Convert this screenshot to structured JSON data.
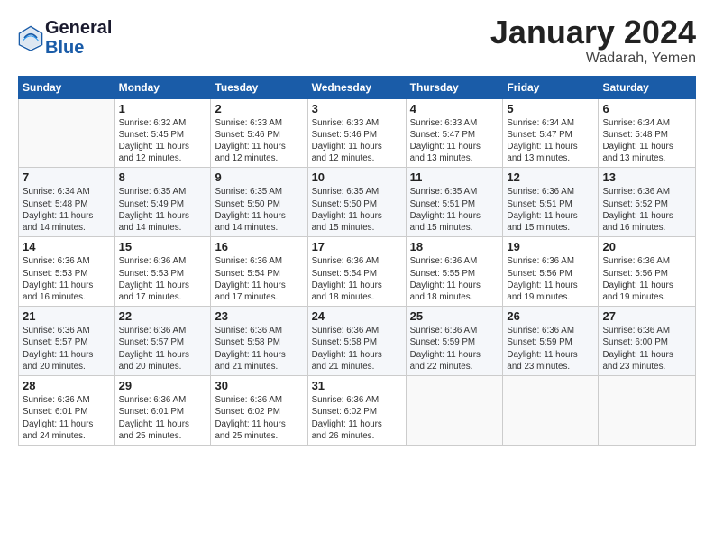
{
  "header": {
    "logo_line1": "General",
    "logo_line2": "Blue",
    "month_title": "January 2024",
    "location": "Wadarah, Yemen"
  },
  "days_of_week": [
    "Sunday",
    "Monday",
    "Tuesday",
    "Wednesday",
    "Thursday",
    "Friday",
    "Saturday"
  ],
  "weeks": [
    [
      {
        "day": "",
        "info": ""
      },
      {
        "day": "1",
        "info": "Sunrise: 6:32 AM\nSunset: 5:45 PM\nDaylight: 11 hours\nand 12 minutes."
      },
      {
        "day": "2",
        "info": "Sunrise: 6:33 AM\nSunset: 5:46 PM\nDaylight: 11 hours\nand 12 minutes."
      },
      {
        "day": "3",
        "info": "Sunrise: 6:33 AM\nSunset: 5:46 PM\nDaylight: 11 hours\nand 12 minutes."
      },
      {
        "day": "4",
        "info": "Sunrise: 6:33 AM\nSunset: 5:47 PM\nDaylight: 11 hours\nand 13 minutes."
      },
      {
        "day": "5",
        "info": "Sunrise: 6:34 AM\nSunset: 5:47 PM\nDaylight: 11 hours\nand 13 minutes."
      },
      {
        "day": "6",
        "info": "Sunrise: 6:34 AM\nSunset: 5:48 PM\nDaylight: 11 hours\nand 13 minutes."
      }
    ],
    [
      {
        "day": "7",
        "info": "Sunrise: 6:34 AM\nSunset: 5:48 PM\nDaylight: 11 hours\nand 14 minutes."
      },
      {
        "day": "8",
        "info": "Sunrise: 6:35 AM\nSunset: 5:49 PM\nDaylight: 11 hours\nand 14 minutes."
      },
      {
        "day": "9",
        "info": "Sunrise: 6:35 AM\nSunset: 5:50 PM\nDaylight: 11 hours\nand 14 minutes."
      },
      {
        "day": "10",
        "info": "Sunrise: 6:35 AM\nSunset: 5:50 PM\nDaylight: 11 hours\nand 15 minutes."
      },
      {
        "day": "11",
        "info": "Sunrise: 6:35 AM\nSunset: 5:51 PM\nDaylight: 11 hours\nand 15 minutes."
      },
      {
        "day": "12",
        "info": "Sunrise: 6:36 AM\nSunset: 5:51 PM\nDaylight: 11 hours\nand 15 minutes."
      },
      {
        "day": "13",
        "info": "Sunrise: 6:36 AM\nSunset: 5:52 PM\nDaylight: 11 hours\nand 16 minutes."
      }
    ],
    [
      {
        "day": "14",
        "info": "Sunrise: 6:36 AM\nSunset: 5:53 PM\nDaylight: 11 hours\nand 16 minutes."
      },
      {
        "day": "15",
        "info": "Sunrise: 6:36 AM\nSunset: 5:53 PM\nDaylight: 11 hours\nand 17 minutes."
      },
      {
        "day": "16",
        "info": "Sunrise: 6:36 AM\nSunset: 5:54 PM\nDaylight: 11 hours\nand 17 minutes."
      },
      {
        "day": "17",
        "info": "Sunrise: 6:36 AM\nSunset: 5:54 PM\nDaylight: 11 hours\nand 18 minutes."
      },
      {
        "day": "18",
        "info": "Sunrise: 6:36 AM\nSunset: 5:55 PM\nDaylight: 11 hours\nand 18 minutes."
      },
      {
        "day": "19",
        "info": "Sunrise: 6:36 AM\nSunset: 5:56 PM\nDaylight: 11 hours\nand 19 minutes."
      },
      {
        "day": "20",
        "info": "Sunrise: 6:36 AM\nSunset: 5:56 PM\nDaylight: 11 hours\nand 19 minutes."
      }
    ],
    [
      {
        "day": "21",
        "info": "Sunrise: 6:36 AM\nSunset: 5:57 PM\nDaylight: 11 hours\nand 20 minutes."
      },
      {
        "day": "22",
        "info": "Sunrise: 6:36 AM\nSunset: 5:57 PM\nDaylight: 11 hours\nand 20 minutes."
      },
      {
        "day": "23",
        "info": "Sunrise: 6:36 AM\nSunset: 5:58 PM\nDaylight: 11 hours\nand 21 minutes."
      },
      {
        "day": "24",
        "info": "Sunrise: 6:36 AM\nSunset: 5:58 PM\nDaylight: 11 hours\nand 21 minutes."
      },
      {
        "day": "25",
        "info": "Sunrise: 6:36 AM\nSunset: 5:59 PM\nDaylight: 11 hours\nand 22 minutes."
      },
      {
        "day": "26",
        "info": "Sunrise: 6:36 AM\nSunset: 5:59 PM\nDaylight: 11 hours\nand 23 minutes."
      },
      {
        "day": "27",
        "info": "Sunrise: 6:36 AM\nSunset: 6:00 PM\nDaylight: 11 hours\nand 23 minutes."
      }
    ],
    [
      {
        "day": "28",
        "info": "Sunrise: 6:36 AM\nSunset: 6:01 PM\nDaylight: 11 hours\nand 24 minutes."
      },
      {
        "day": "29",
        "info": "Sunrise: 6:36 AM\nSunset: 6:01 PM\nDaylight: 11 hours\nand 25 minutes."
      },
      {
        "day": "30",
        "info": "Sunrise: 6:36 AM\nSunset: 6:02 PM\nDaylight: 11 hours\nand 25 minutes."
      },
      {
        "day": "31",
        "info": "Sunrise: 6:36 AM\nSunset: 6:02 PM\nDaylight: 11 hours\nand 26 minutes."
      },
      {
        "day": "",
        "info": ""
      },
      {
        "day": "",
        "info": ""
      },
      {
        "day": "",
        "info": ""
      }
    ]
  ]
}
